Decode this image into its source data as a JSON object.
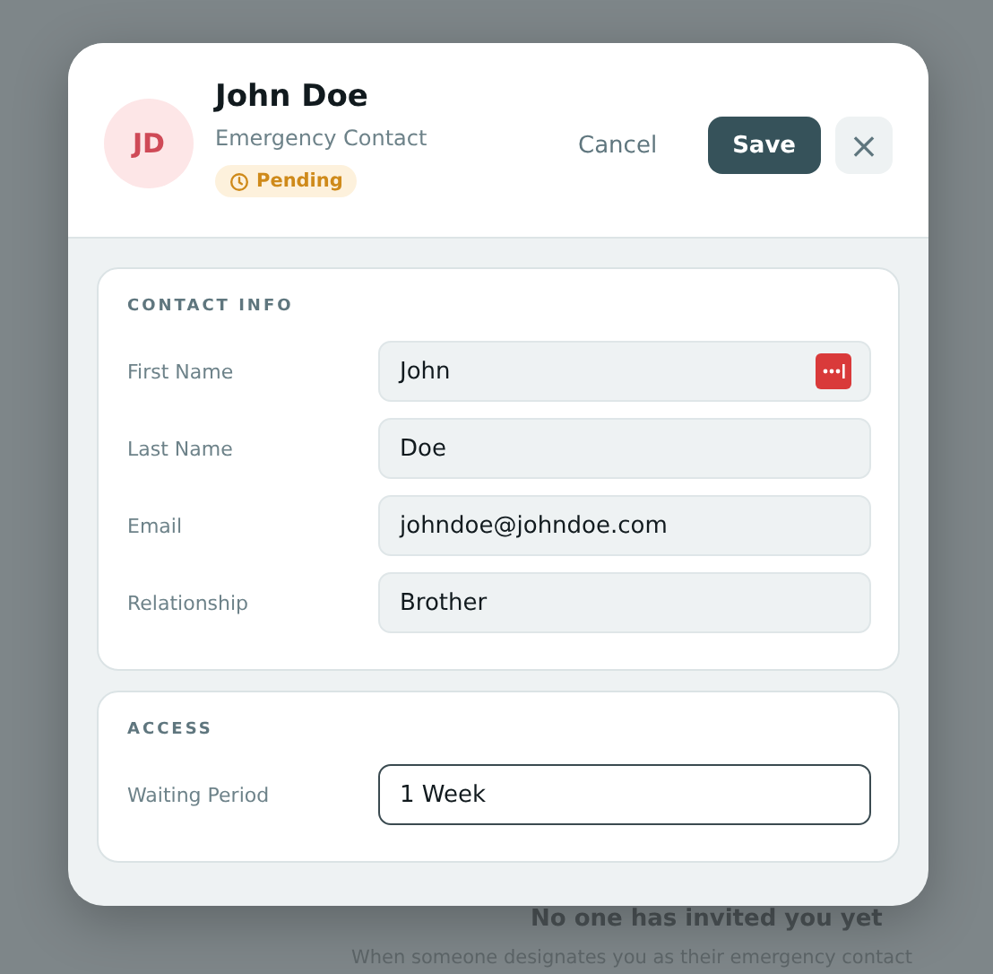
{
  "background": {
    "empty_title": "No one has invited you yet",
    "empty_text": "When someone designates you as their emergency contact"
  },
  "dialog": {
    "avatar": "JD",
    "name": "John Doe",
    "subtitle": "Emergency Contact",
    "status": {
      "label": "Pending",
      "kind": "pending"
    },
    "buttons": [
      {
        "label": "Cancel",
        "kind": "text"
      },
      {
        "label": "Save",
        "kind": "primary"
      },
      {
        "label": "×",
        "kind": "close"
      }
    ],
    "sections": [
      {
        "title": "CONTACT INFO",
        "fields": [
          {
            "label": "First Name",
            "value": "John",
            "focused": false,
            "autofill_icon": true
          },
          {
            "label": "Last Name",
            "value": "Doe",
            "focused": false,
            "autofill_icon": false
          },
          {
            "label": "Email",
            "value": "johndoe@johndoe.com",
            "focused": false,
            "autofill_icon": false
          },
          {
            "label": "Relationship",
            "value": "Brother",
            "focused": false,
            "autofill_icon": false
          }
        ]
      },
      {
        "title": "ACCESS",
        "fields": [
          {
            "label": "Waiting Period",
            "value": "1 Week",
            "focused": true,
            "autofill_icon": false
          }
        ]
      }
    ]
  }
}
